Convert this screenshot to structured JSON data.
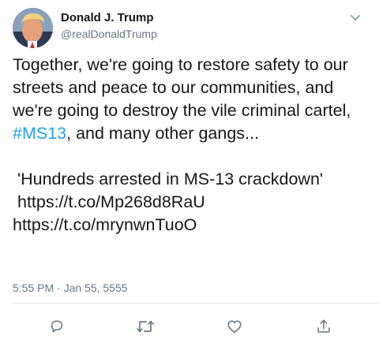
{
  "user": {
    "display_name": "Donald J. Trump",
    "handle": "@realDonaldTrump"
  },
  "tweet": {
    "text_before_hashtag": "Together, we're going to restore safety to our streets and peace to our communities, and we're going to destroy the vile criminal cartel, ",
    "hashtag": "#MS13",
    "text_after_hashtag": ", and many other gangs...",
    "quote": "'Hundreds arrested in MS-13 crackdown'",
    "link_1": "https://t.co/Mp268d8RaU",
    "link_2": "https://t.co/mrynwnTuoO"
  },
  "timestamp": "5:55 PM · Jan 55, 5555",
  "icons": {
    "menu": "chevron-down-icon",
    "reply": "reply-icon",
    "retweet": "retweet-icon",
    "like": "like-icon",
    "share": "share-icon"
  },
  "colors": {
    "hashtag": "#1da1f2",
    "secondary_text": "#657786",
    "icon": "#657786",
    "divider": "#e6ecf0"
  }
}
